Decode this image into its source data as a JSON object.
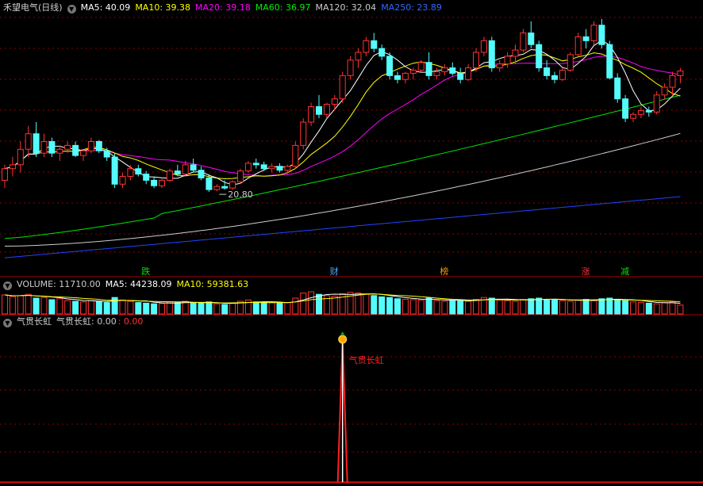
{
  "colors": {
    "up": "#ff3232",
    "down": "#54fcfc",
    "ma5": "#ffffff",
    "ma10": "#ffff00",
    "ma20": "#ff00ff",
    "ma60": "#00e600",
    "ma120": "#cccccc",
    "ma250": "#2244ff",
    "grid": "#8b0000",
    "signal": "#ff2020"
  },
  "price_panel": {
    "title": "禾望电气(日线)",
    "ma5_label": "MA5: 40.09",
    "ma10_label": "MA10: 39.38",
    "ma20_label": "MA20: 39.18",
    "ma60_label": "MA60: 36.97",
    "ma120_label": "MA120: 32.04",
    "ma250_label": "MA250: 23.89",
    "low_label": "20.80",
    "markers": [
      {
        "text": "跌",
        "color": "#00e600"
      },
      {
        "text": "财",
        "color": "#4aa8ff"
      },
      {
        "text": "榜",
        "color": "#ff9900"
      },
      {
        "text": "涨",
        "color": "#ff3232"
      },
      {
        "text": "减",
        "color": "#00e600"
      }
    ]
  },
  "volume_panel": {
    "title": "VOLUME: 11710.00",
    "ma5_label": "MA5: 44238.09",
    "ma10_label": "MA10: 59381.63"
  },
  "indicator_panel": {
    "title": "气贯长虹",
    "value_label": "气贯长虹: 0.00",
    "value2_label": ": 0.00",
    "signal_label": "气贯长虹"
  },
  "chart_data": {
    "type": "candlestick",
    "price_range": [
      15,
      47
    ],
    "candles": [
      [
        26,
        28,
        25,
        27.5
      ],
      [
        27.5,
        29,
        26.5,
        28
      ],
      [
        28,
        31,
        27,
        30
      ],
      [
        30,
        33,
        29,
        32
      ],
      [
        32,
        33.5,
        29,
        29.5
      ],
      [
        29.5,
        32,
        29,
        31
      ],
      [
        31,
        31.5,
        29,
        29.5
      ],
      [
        29.5,
        30.5,
        28.5,
        30
      ],
      [
        30,
        31,
        29.5,
        30.5
      ],
      [
        30.5,
        31,
        29,
        29.2
      ],
      [
        29.2,
        30,
        28.5,
        29.8
      ],
      [
        29.8,
        31.5,
        29.5,
        31
      ],
      [
        31,
        31.2,
        29.5,
        29.8
      ],
      [
        29.8,
        30.2,
        28.5,
        29
      ],
      [
        29,
        29.5,
        25,
        25.5
      ],
      [
        25.5,
        27,
        25,
        26.5
      ],
      [
        26.5,
        28,
        26,
        27.5
      ],
      [
        27.5,
        28,
        26.5,
        26.8
      ],
      [
        26.8,
        27.2,
        25.5,
        26
      ],
      [
        26,
        26.5,
        25,
        25.3
      ],
      [
        25.3,
        26.2,
        25,
        26
      ],
      [
        26,
        27.5,
        25.8,
        27.2
      ],
      [
        27.2,
        28,
        26.5,
        26.8
      ],
      [
        26.8,
        28.5,
        26.5,
        28
      ],
      [
        28,
        28.8,
        27,
        27.3
      ],
      [
        27.3,
        27.8,
        26,
        26.3
      ],
      [
        26.3,
        26.8,
        24.5,
        24.8
      ],
      [
        24.8,
        25.5,
        24.6,
        25.2
      ],
      [
        25.2,
        26,
        24.8,
        25
      ],
      [
        25,
        26,
        24.8,
        25.8
      ],
      [
        25.8,
        27.5,
        25.5,
        27.2
      ],
      [
        27.2,
        28.5,
        27,
        28.2
      ],
      [
        28.2,
        28.8,
        27.5,
        28
      ],
      [
        28,
        28.4,
        27.2,
        27.5
      ],
      [
        27.5,
        28.2,
        27,
        27.8
      ],
      [
        27.8,
        28.2,
        27,
        27.3
      ],
      [
        27.3,
        28,
        26.8,
        27.8
      ],
      [
        27.8,
        31,
        27.5,
        30.5
      ],
      [
        30.5,
        34,
        30,
        33.5
      ],
      [
        33.5,
        36,
        33,
        35.5
      ],
      [
        35.5,
        37,
        34,
        34.5
      ],
      [
        34.5,
        36,
        34,
        35.8
      ],
      [
        35.8,
        37,
        35,
        36.5
      ],
      [
        36.5,
        40,
        36,
        39.5
      ],
      [
        39.5,
        42,
        39,
        41.5
      ],
      [
        41.5,
        43,
        40.5,
        42.5
      ],
      [
        42.5,
        44.5,
        42,
        44
      ],
      [
        44,
        45,
        42.5,
        43
      ],
      [
        43,
        43.5,
        41.5,
        42
      ],
      [
        42,
        42.5,
        39,
        39.5
      ],
      [
        39.5,
        40,
        38.5,
        39
      ],
      [
        39,
        40,
        38.5,
        39.8
      ],
      [
        39.8,
        40.5,
        39,
        40.2
      ],
      [
        40.2,
        41.5,
        40,
        41.2
      ],
      [
        41.2,
        42.5,
        39,
        39.5
      ],
      [
        39.5,
        40.5,
        39,
        40
      ],
      [
        40,
        41,
        39.5,
        40.5
      ],
      [
        40.5,
        41.2,
        39.5,
        39.8
      ],
      [
        39.8,
        40.5,
        38.5,
        39
      ],
      [
        39,
        41,
        38.8,
        40.5
      ],
      [
        40.5,
        43,
        40,
        42.5
      ],
      [
        42.5,
        44.5,
        42,
        44
      ],
      [
        44,
        44.5,
        40,
        40.5
      ],
      [
        40.5,
        41.5,
        40,
        41
      ],
      [
        41,
        42.5,
        40.5,
        42
      ],
      [
        42,
        43.5,
        41,
        42.8
      ],
      [
        42.8,
        45.5,
        42.5,
        45
      ],
      [
        45,
        46.5,
        43,
        43.5
      ],
      [
        43.5,
        44,
        40,
        40.5
      ],
      [
        40.5,
        41.5,
        39,
        39.5
      ],
      [
        39.5,
        40,
        38.5,
        39
      ],
      [
        39,
        40.5,
        38.8,
        40.2
      ],
      [
        40.2,
        42.5,
        40,
        42.2
      ],
      [
        42.2,
        45,
        42,
        44.5
      ],
      [
        44.5,
        45.5,
        43,
        44
      ],
      [
        44,
        46.5,
        43.5,
        46
      ],
      [
        46,
        46.8,
        43,
        43.5
      ],
      [
        43.5,
        44,
        39,
        39.2
      ],
      [
        39.2,
        39.8,
        36,
        36.5
      ],
      [
        36.5,
        37,
        33.5,
        34
      ],
      [
        34,
        34.8,
        33.5,
        34.5
      ],
      [
        34.5,
        35.5,
        34,
        35
      ],
      [
        35,
        35.5,
        34.2,
        34.8
      ],
      [
        34.8,
        37.5,
        34.5,
        37
      ],
      [
        37,
        38.5,
        36.5,
        38
      ],
      [
        38,
        40,
        37,
        39.5
      ],
      [
        39.5,
        40.5,
        38.5,
        40.09
      ]
    ],
    "volume": [
      60,
      55,
      58,
      62,
      50,
      52,
      45,
      48,
      42,
      40,
      38,
      42,
      40,
      36,
      52,
      44,
      40,
      36,
      34,
      32,
      33,
      38,
      36,
      40,
      35,
      34,
      38,
      32,
      30,
      34,
      40,
      44,
      38,
      36,
      35,
      34,
      36,
      50,
      66,
      70,
      62,
      58,
      56,
      64,
      68,
      66,
      62,
      58,
      54,
      52,
      48,
      46,
      45,
      44,
      50,
      42,
      40,
      42,
      44,
      40,
      46,
      52,
      50,
      44,
      42,
      40,
      46,
      48,
      50,
      46,
      44,
      42,
      40,
      44,
      46,
      42,
      48,
      50,
      46,
      42,
      38,
      36,
      34,
      32,
      36,
      38,
      28
    ],
    "signal_index": 43
  }
}
